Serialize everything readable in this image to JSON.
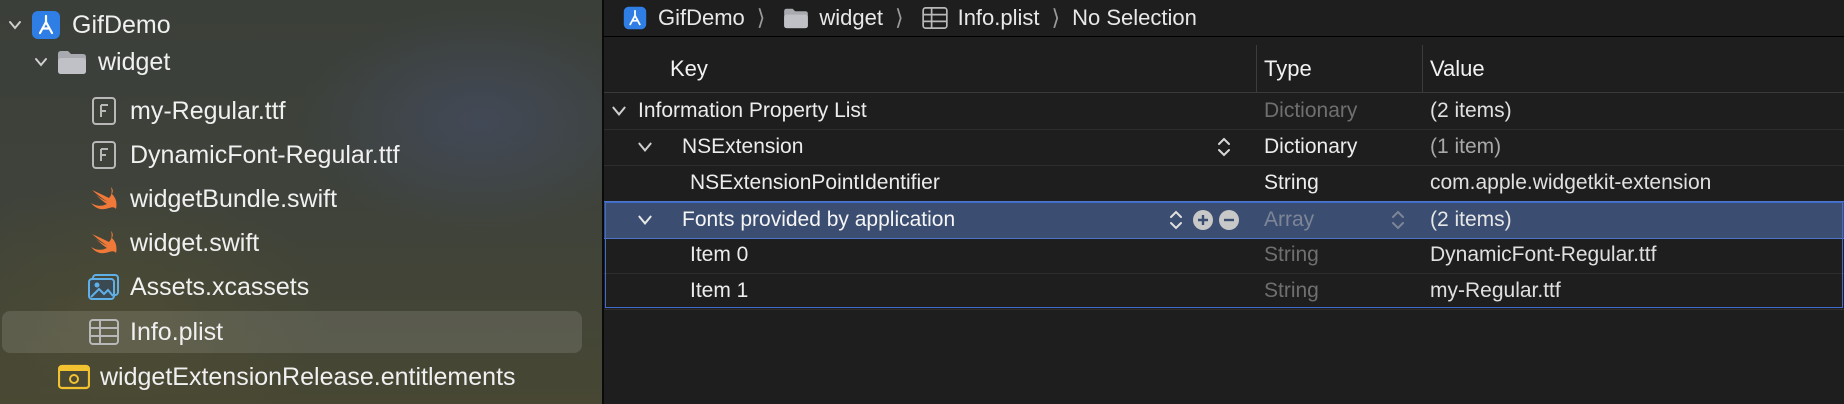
{
  "sidebar": {
    "items": [
      {
        "label": "GifDemo",
        "icon": "xcode-project-icon"
      },
      {
        "label": "widget",
        "icon": "folder-icon"
      },
      {
        "label": "my-Regular.ttf",
        "icon": "font-file-icon"
      },
      {
        "label": "DynamicFont-Regular.ttf",
        "icon": "font-file-icon"
      },
      {
        "label": "widgetBundle.swift",
        "icon": "swift-icon"
      },
      {
        "label": "widget.swift",
        "icon": "swift-icon"
      },
      {
        "label": "Assets.xcassets",
        "icon": "asset-catalog-icon"
      },
      {
        "label": "Info.plist",
        "icon": "plist-icon"
      },
      {
        "label": "widgetExtensionRelease.entitlements",
        "icon": "entitlements-icon"
      }
    ],
    "selected": "Info.plist"
  },
  "jumpbar": {
    "crumbs": [
      "GifDemo",
      "widget",
      "Info.plist",
      "No Selection"
    ]
  },
  "plist": {
    "headers": {
      "key": "Key",
      "type": "Type",
      "value": "Value"
    },
    "rows": [
      {
        "key": "Information Property List",
        "type": "Dictionary",
        "value": "(2 items)"
      },
      {
        "key": "NSExtension",
        "type": "Dictionary",
        "value": "(1 item)"
      },
      {
        "key": "NSExtensionPointIdentifier",
        "type": "String",
        "value": "com.apple.widgetkit-extension"
      },
      {
        "key": "Fonts provided by application",
        "type": "Array",
        "value": "(2 items)"
      },
      {
        "key": "Item 0",
        "type": "String",
        "value": "DynamicFont-Regular.ttf"
      },
      {
        "key": "Item 1",
        "type": "String",
        "value": "my-Regular.ttf"
      }
    ]
  },
  "colors": {
    "selection": "#3b4e71",
    "selection_border": "#3f6bd0",
    "swift_orange": "#f0793a",
    "xcode_blue": "#2f7ee6"
  }
}
